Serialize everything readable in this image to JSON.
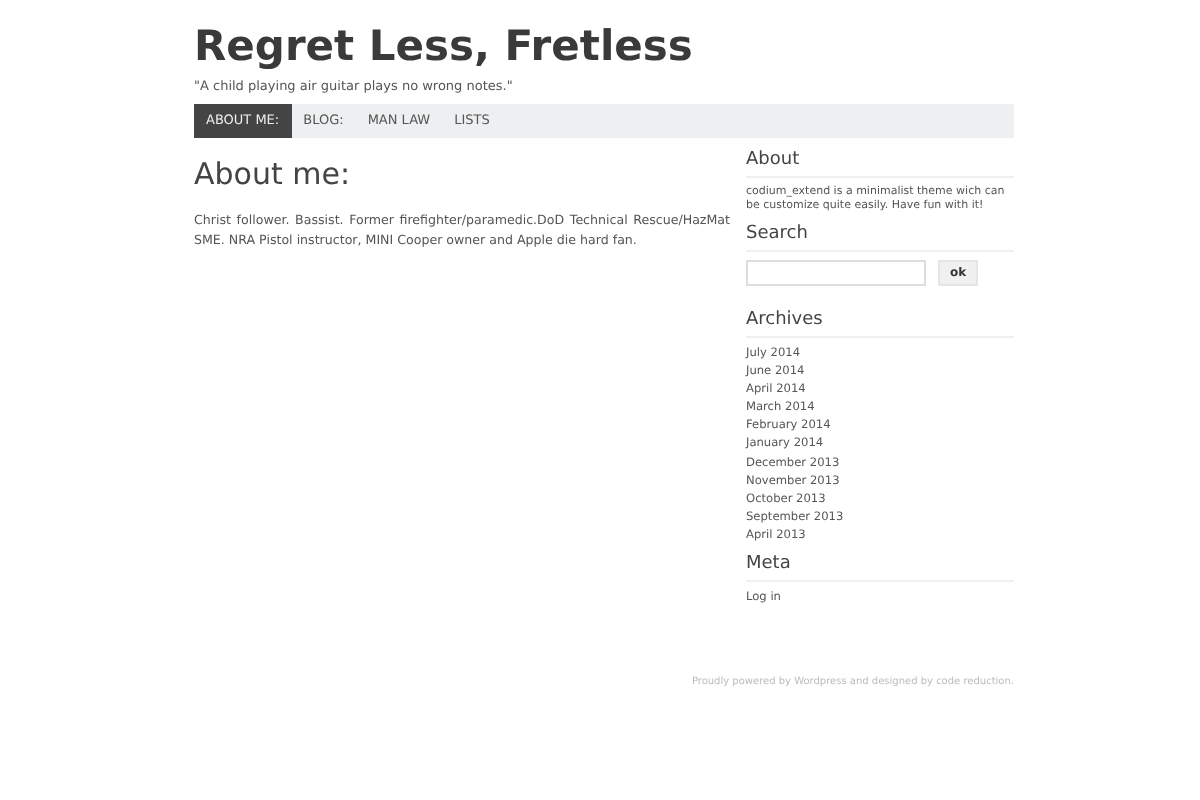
{
  "site": {
    "title": "Regret Less, Fretless",
    "tagline": "\"A child playing air guitar plays no wrong notes.\""
  },
  "nav": [
    {
      "label": "ABOUT ME:",
      "selected": true
    },
    {
      "label": "BLOG:",
      "selected": false
    },
    {
      "label": "MAN LAW",
      "selected": false
    },
    {
      "label": "LISTS",
      "selected": false
    }
  ],
  "page": {
    "heading": "About me:",
    "body": "Christ follower. Bassist. Former firefighter/paramedic.DoD Technical Rescue/HazMat SME. NRA Pistol instructor, MINI Cooper owner and Apple die hard fan."
  },
  "sidebar": {
    "about": {
      "title": "About",
      "text": "codium_extend is a minimalist theme wich can be customize quite easily. Have fun with it!"
    },
    "search": {
      "title": "Search",
      "button": "ok"
    },
    "archives": {
      "title": "Archives",
      "items": [
        "July 2014",
        "June 2014",
        "April 2014",
        "March 2014",
        "February 2014",
        "January 2014",
        "December 2013",
        "November 2013",
        "October 2013",
        "September 2013",
        "April 2013"
      ]
    },
    "meta": {
      "title": "Meta",
      "items": [
        "Log in"
      ]
    }
  },
  "footer": "Proudly powered by Wordpress and designed by code reduction."
}
